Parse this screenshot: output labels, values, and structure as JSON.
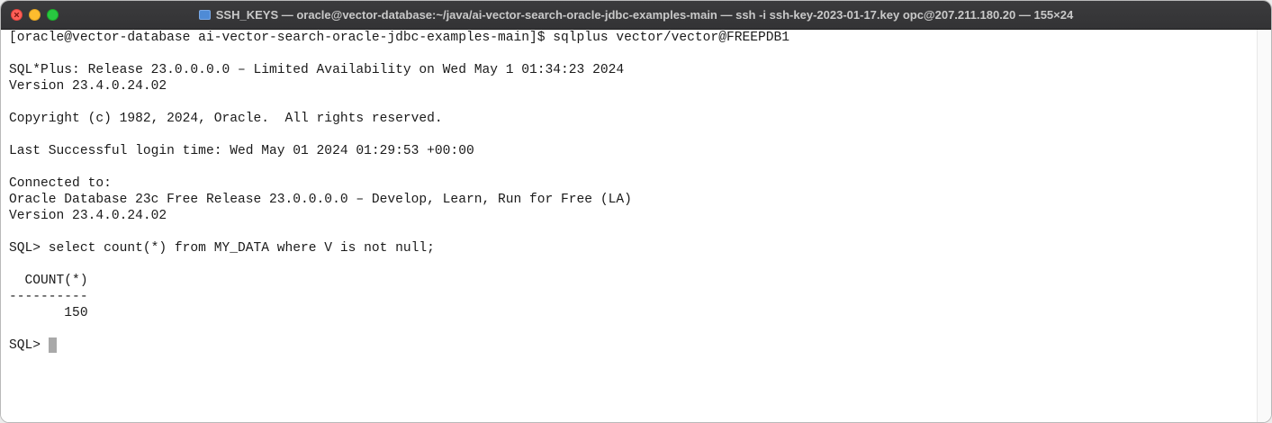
{
  "window": {
    "title": "SSH_KEYS — oracle@vector-database:~/java/ai-vector-search-oracle-jdbc-examples-main — ssh -i ssh-key-2023-01-17.key opc@207.211.180.20 — 155×24",
    "folder_icon": "folder-icon",
    "colors": {
      "close": "#ff5f57",
      "minimize": "#febc2e",
      "maximize": "#28c840",
      "titlebar": "#363638",
      "terminal_bg": "#ffffff",
      "terminal_fg": "#1a1a1a",
      "cursor": "#a9a9a9"
    }
  },
  "terminal": {
    "lines": [
      "[oracle@vector-database ai-vector-search-oracle-jdbc-examples-main]$ sqlplus vector/vector@FREEPDB1",
      "",
      "SQL*Plus: Release 23.0.0.0.0 – Limited Availability on Wed May 1 01:34:23 2024",
      "Version 23.4.0.24.02",
      "",
      "Copyright (c) 1982, 2024, Oracle.  All rights reserved.",
      "",
      "Last Successful login time: Wed May 01 2024 01:29:53 +00:00",
      "",
      "Connected to:",
      "Oracle Database 23c Free Release 23.0.0.0.0 – Develop, Learn, Run for Free (LA)",
      "Version 23.4.0.24.02",
      "",
      "SQL> select count(*) from MY_DATA where V is not null;",
      "",
      "  COUNT(*)",
      "----------",
      "       150",
      ""
    ],
    "prompt": "SQL> "
  }
}
